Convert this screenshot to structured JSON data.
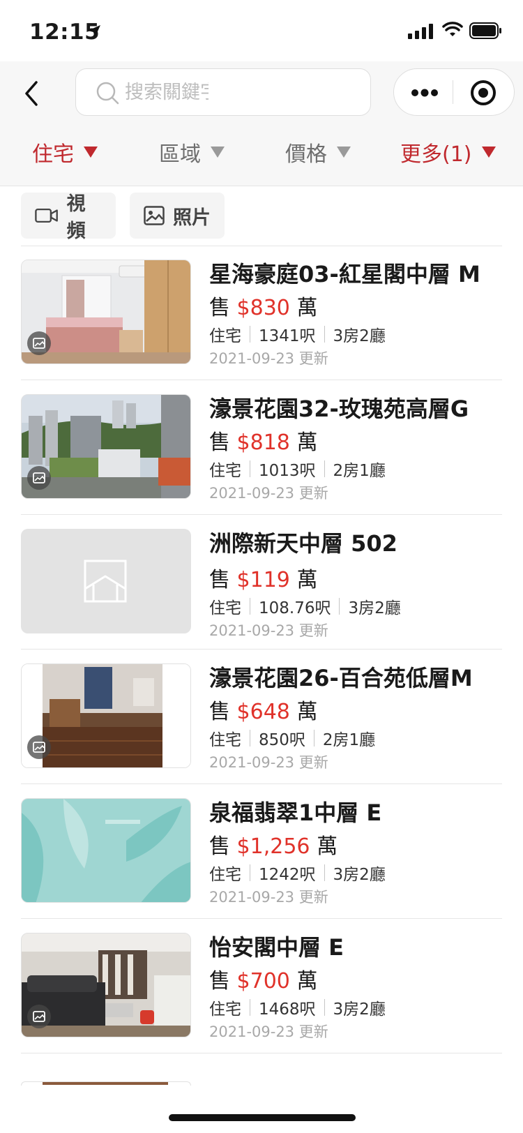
{
  "status_bar": {
    "time": "12:15"
  },
  "search": {
    "placeholder": "搜索關鍵字"
  },
  "filters": [
    {
      "label": "住宅",
      "active": true
    },
    {
      "label": "區域",
      "active": false
    },
    {
      "label": "價格",
      "active": false
    },
    {
      "label": "更多(1)",
      "active": true
    }
  ],
  "media_filters": [
    {
      "label": "視頻",
      "icon": "video-icon"
    },
    {
      "label": "照片",
      "icon": "photo-icon"
    }
  ],
  "listings": [
    {
      "title": "星海豪庭03-紅星閣中層 M",
      "sale_prefix": "售",
      "price": "$830",
      "price_unit": "萬",
      "type": "住宅",
      "area": "1341呎",
      "rooms": "3房2廳",
      "date": "2021-09-23 更新",
      "has_image": true
    },
    {
      "title": "濠景花園32-玫瑰苑高層G",
      "sale_prefix": "售",
      "price": "$818",
      "price_unit": "萬",
      "type": "住宅",
      "area": "1013呎",
      "rooms": "2房1廳",
      "date": "2021-09-23 更新",
      "has_image": true
    },
    {
      "title": "洲際新天中層 502",
      "sale_prefix": "售",
      "price": "$119",
      "price_unit": "萬",
      "type": "住宅",
      "area": "108.76呎",
      "rooms": "3房2廳",
      "date": "2021-09-23 更新",
      "has_image": false
    },
    {
      "title": "濠景花園26-百合苑低層M",
      "sale_prefix": "售",
      "price": "$648",
      "price_unit": "萬",
      "type": "住宅",
      "area": "850呎",
      "rooms": "2房1廳",
      "date": "2021-09-23 更新",
      "has_image": true
    },
    {
      "title": "泉福翡翠1中層 E",
      "sale_prefix": "售",
      "price": "$1,256",
      "price_unit": "萬",
      "type": "住宅",
      "area": "1242呎",
      "rooms": "3房2廳",
      "date": "2021-09-23 更新",
      "has_image": true
    },
    {
      "title": "怡安閣中層 E",
      "sale_prefix": "售",
      "price": "$700",
      "price_unit": "萬",
      "type": "住宅",
      "area": "1468呎",
      "rooms": "3房2廳",
      "date": "2021-09-23 更新",
      "has_image": true
    }
  ],
  "colors": {
    "accent": "#c0292e",
    "price": "#e0322a"
  }
}
